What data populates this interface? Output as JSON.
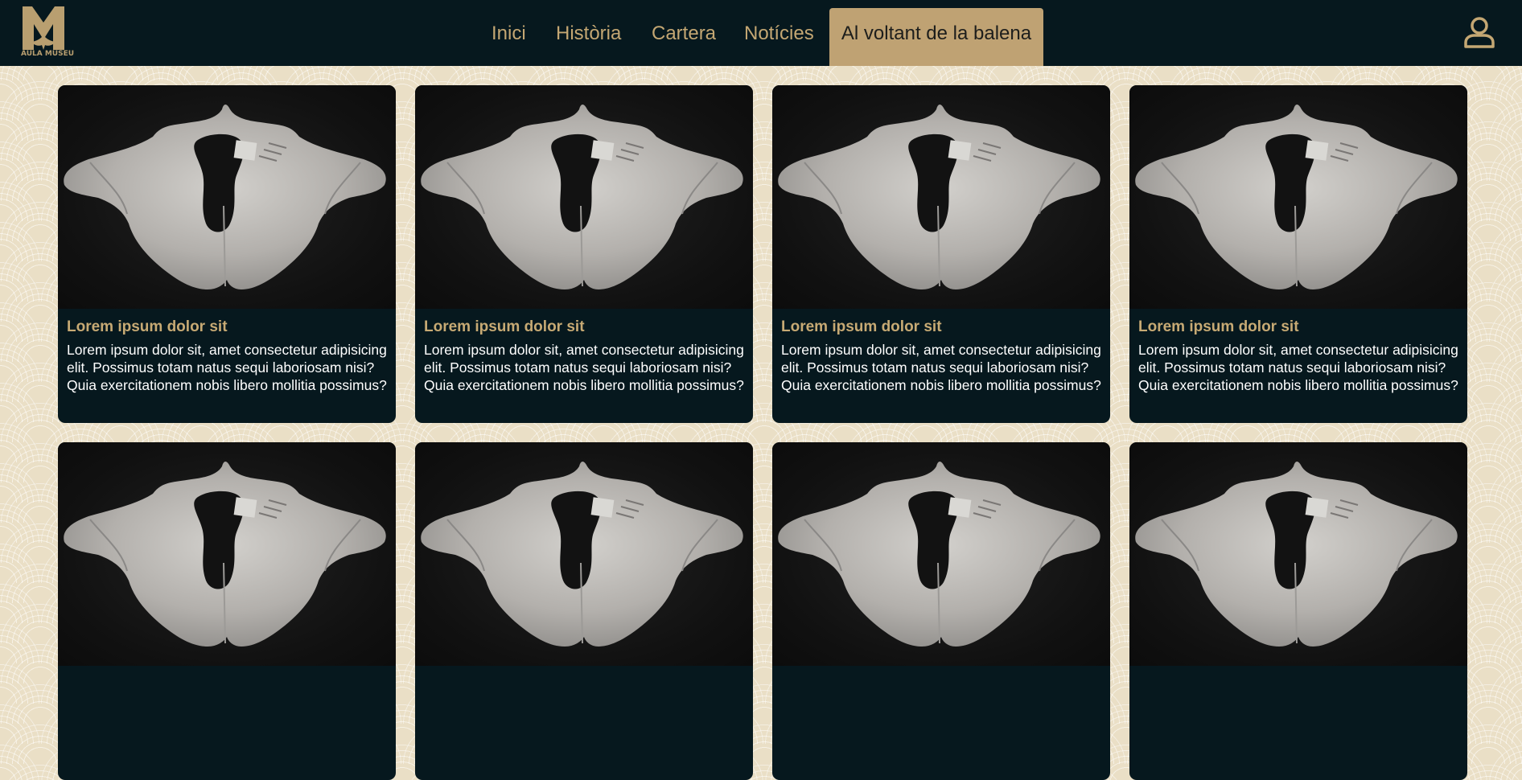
{
  "logo": {
    "text": "AULA MUSEU",
    "icon": "whale-tail-logo-icon"
  },
  "nav": {
    "items": [
      {
        "label": "Inici"
      },
      {
        "label": "Història"
      },
      {
        "label": "Cartera"
      },
      {
        "label": "Notícies"
      },
      {
        "label": "Al voltant de la balena"
      }
    ],
    "active_index": 4
  },
  "user_icon": "user-icon",
  "colors": {
    "header_bg": "#06181e",
    "accent": "#c4a773",
    "active_tab": "#bfa273",
    "card_bg": "#06181e"
  },
  "cards": [
    {
      "image": "whale-vertebra-image",
      "title": "Lorem ipsum dolor sit",
      "text": "Lorem ipsum dolor sit, amet consectetur adipisicing elit. Possimus totam natus sequi laboriosam nisi? Quia exercitationem nobis libero mollitia possimus?"
    },
    {
      "image": "whale-vertebra-image",
      "title": "Lorem ipsum dolor sit",
      "text": "Lorem ipsum dolor sit, amet consectetur adipisicing elit. Possimus totam natus sequi laboriosam nisi? Quia exercitationem nobis libero mollitia possimus?"
    },
    {
      "image": "whale-vertebra-image",
      "title": "Lorem ipsum dolor sit",
      "text": "Lorem ipsum dolor sit, amet consectetur adipisicing elit. Possimus totam natus sequi laboriosam nisi? Quia exercitationem nobis libero mollitia possimus?"
    },
    {
      "image": "whale-vertebra-image",
      "title": "Lorem ipsum dolor sit",
      "text": "Lorem ipsum dolor sit, amet consectetur adipisicing elit. Possimus totam natus sequi laboriosam nisi? Quia exercitationem nobis libero mollitia possimus?"
    },
    {
      "image": "whale-vertebra-image"
    },
    {
      "image": "whale-vertebra-image"
    },
    {
      "image": "whale-vertebra-image"
    },
    {
      "image": "whale-vertebra-image"
    }
  ]
}
